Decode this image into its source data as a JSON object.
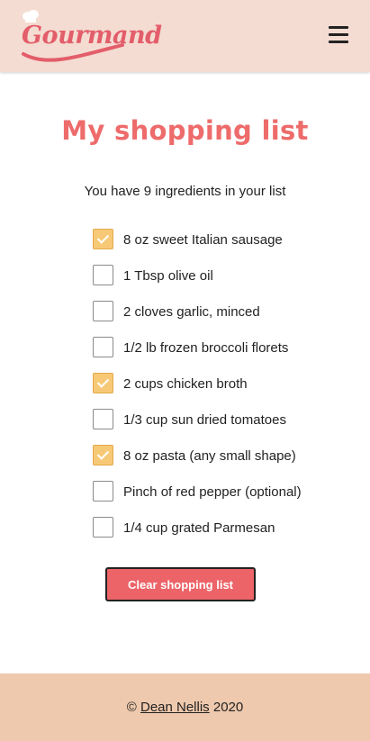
{
  "brand": {
    "logo_text": "Gourmand",
    "logo_color": "#e35d6a"
  },
  "header": {
    "background": "#f4dcd2",
    "menu_icon": "hamburger-menu-icon"
  },
  "main": {
    "title": "My shopping list",
    "summary": "You have 9 ingredients in your list",
    "items": [
      {
        "label": "8 oz sweet Italian sausage",
        "checked": true
      },
      {
        "label": "1 Tbsp olive oil",
        "checked": false
      },
      {
        "label": "2 cloves garlic, minced",
        "checked": false
      },
      {
        "label": "1/2 lb frozen broccoli florets",
        "checked": false
      },
      {
        "label": "2 cups chicken broth",
        "checked": true
      },
      {
        "label": "1/3 cup sun dried tomatoes",
        "checked": false
      },
      {
        "label": "8 oz pasta (any small shape)",
        "checked": true
      },
      {
        "label": "Pinch of red pepper (optional)",
        "checked": false
      },
      {
        "label": "1/4 cup grated Parmesan",
        "checked": false
      }
    ],
    "clear_button_label": "Clear shopping list"
  },
  "footer": {
    "copyright_symbol": "©",
    "author": "Dean Nellis",
    "year": "2020",
    "background": "#efc9ad"
  },
  "colors": {
    "accent": "#ec6468",
    "checked": "#f7c976",
    "title": "#ee6b6b"
  }
}
